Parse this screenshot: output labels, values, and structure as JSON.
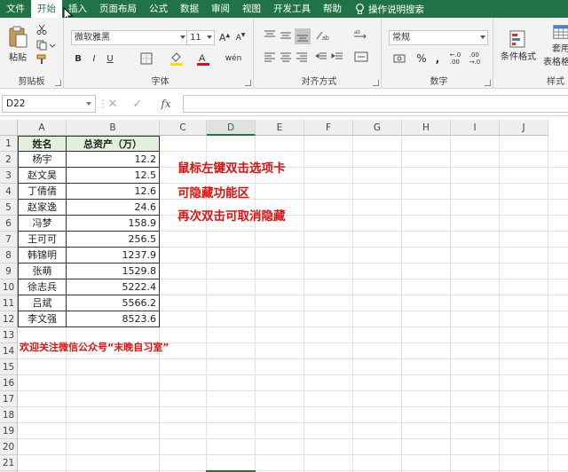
{
  "ribbon_tabs": [
    "文件",
    "开始",
    "插入",
    "页面布局",
    "公式",
    "数据",
    "审阅",
    "视图",
    "开发工具",
    "帮助"
  ],
  "tell_me": "操作说明搜索",
  "clipboard": {
    "paste": "粘贴",
    "group": "剪贴板"
  },
  "font": {
    "name": "微软雅黑",
    "size": "11",
    "bold": "B",
    "italic": "I",
    "underline": "U",
    "group": "字体"
  },
  "alignment": {
    "group": "对齐方式"
  },
  "number": {
    "format": "常规",
    "group": "数字"
  },
  "styles": {
    "conditional": "条件格式",
    "table_1": "套用",
    "table_2": "表格格式",
    "group": "样式"
  },
  "formula_bar": {
    "name_box": "D22",
    "fx": "fx"
  },
  "columns": [
    "A",
    "B",
    "C",
    "D",
    "E",
    "F",
    "G",
    "H",
    "I",
    "J"
  ],
  "rows": [
    "1",
    "2",
    "3",
    "4",
    "5",
    "6",
    "7",
    "8",
    "9",
    "10",
    "11",
    "12",
    "13",
    "14",
    "15",
    "16",
    "17",
    "18",
    "19",
    "20",
    "21",
    "22"
  ],
  "table": {
    "headers": [
      "姓名",
      "总资产（万）"
    ],
    "rows": [
      [
        "杨宇",
        "12.2"
      ],
      [
        "赵文昊",
        "12.5"
      ],
      [
        "丁倩倩",
        "12.6"
      ],
      [
        "赵家逸",
        "24.6"
      ],
      [
        "冯梦",
        "158.9"
      ],
      [
        "王可可",
        "256.5"
      ],
      [
        "韩锦明",
        "1237.9"
      ],
      [
        "张萌",
        "1529.8"
      ],
      [
        "徐志兵",
        "5222.4"
      ],
      [
        "吕斌",
        "5566.2"
      ],
      [
        "李文强",
        "8523.6"
      ]
    ]
  },
  "notes": [
    "鼠标左键双击选项卡",
    "可隐藏功能区",
    "再次双击可取消隐藏"
  ],
  "footer_note": "欢迎关注微信公众号“末晚自习室”",
  "colors": {
    "accent": "#217346",
    "note": "#e01010",
    "header_fill": "#e2efda"
  }
}
